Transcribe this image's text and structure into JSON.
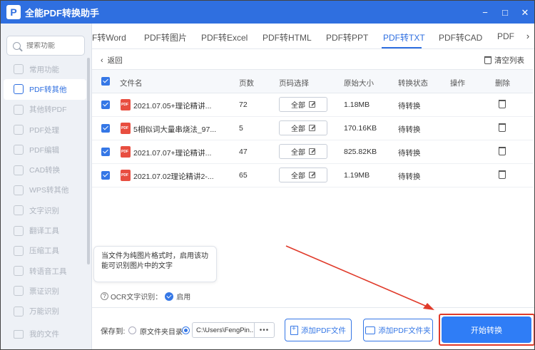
{
  "app": {
    "title": "全能PDF转换助手",
    "logo_letter": "P"
  },
  "window_controls": {
    "minimize": "−",
    "maximize": "□",
    "close": "✕"
  },
  "sidebar": {
    "search_placeholder": "搜索功能",
    "items": [
      {
        "label": "常用功能",
        "active": false
      },
      {
        "label": "PDF转其他",
        "active": true
      },
      {
        "label": "其他转PDF",
        "active": false
      },
      {
        "label": "PDF处理",
        "active": false
      },
      {
        "label": "PDF编辑",
        "active": false
      },
      {
        "label": "CAD转换",
        "active": false
      },
      {
        "label": "WPS转其他",
        "active": false
      },
      {
        "label": "文字识别",
        "active": false
      },
      {
        "label": "翻译工具",
        "active": false
      },
      {
        "label": "压缩工具",
        "active": false
      },
      {
        "label": "转语音工具",
        "active": false
      },
      {
        "label": "票证识别",
        "active": false
      },
      {
        "label": "万能识别",
        "active": false
      }
    ],
    "bottom_item": "我的文件"
  },
  "tabs": {
    "items": [
      "F转Word",
      "PDF转图片",
      "PDF转Excel",
      "PDF转HTML",
      "PDF转PPT",
      "PDF转TXT",
      "PDF转CAD",
      "PDF"
    ],
    "active_index": 5,
    "next_arrow": "›"
  },
  "toolbar": {
    "back_label": "返回",
    "back_icon": "‹",
    "clear_label": "清空列表"
  },
  "table": {
    "headers": {
      "name": "文件名",
      "pages": "页数",
      "page_select": "页码选择",
      "size": "原始大小",
      "status": "转换状态",
      "action": "操作",
      "delete": "删除"
    },
    "rows": [
      {
        "name": "2021.07.05+理论精讲...",
        "pages": "72",
        "page_select": "全部",
        "size": "1.18MB",
        "status": "待转换"
      },
      {
        "name": "5相似词大量串烧法_97...",
        "pages": "5",
        "page_select": "全部",
        "size": "170.16KB",
        "status": "待转换"
      },
      {
        "name": "2021.07.07+理论精讲...",
        "pages": "47",
        "page_select": "全部",
        "size": "825.82KB",
        "status": "待转换"
      },
      {
        "name": "2021.07.02理论精讲2-...",
        "pages": "65",
        "page_select": "全部",
        "size": "1.19MB",
        "status": "待转换"
      }
    ]
  },
  "ocr": {
    "tooltip_line1": "当文件为纯图片格式时，启用该功",
    "tooltip_line2": "能可识别图片中的文字",
    "question_icon": "?",
    "label": "OCR文字识别：",
    "toggle_label": "启用"
  },
  "footer": {
    "save_to_label": "保存到:",
    "option_source": "原文件夹目录",
    "path_value": "C:\\Users\\FengPin...",
    "path_browse": "•••",
    "add_file_label": "添加PDF文件",
    "add_folder_label": "添加PDF文件夹",
    "start_label": "开始转换"
  },
  "colors": {
    "brand": "#2f6fe0",
    "accent": "#2f7df6",
    "highlight": "#e03a2a",
    "pdf_icon": "#e84e40"
  }
}
